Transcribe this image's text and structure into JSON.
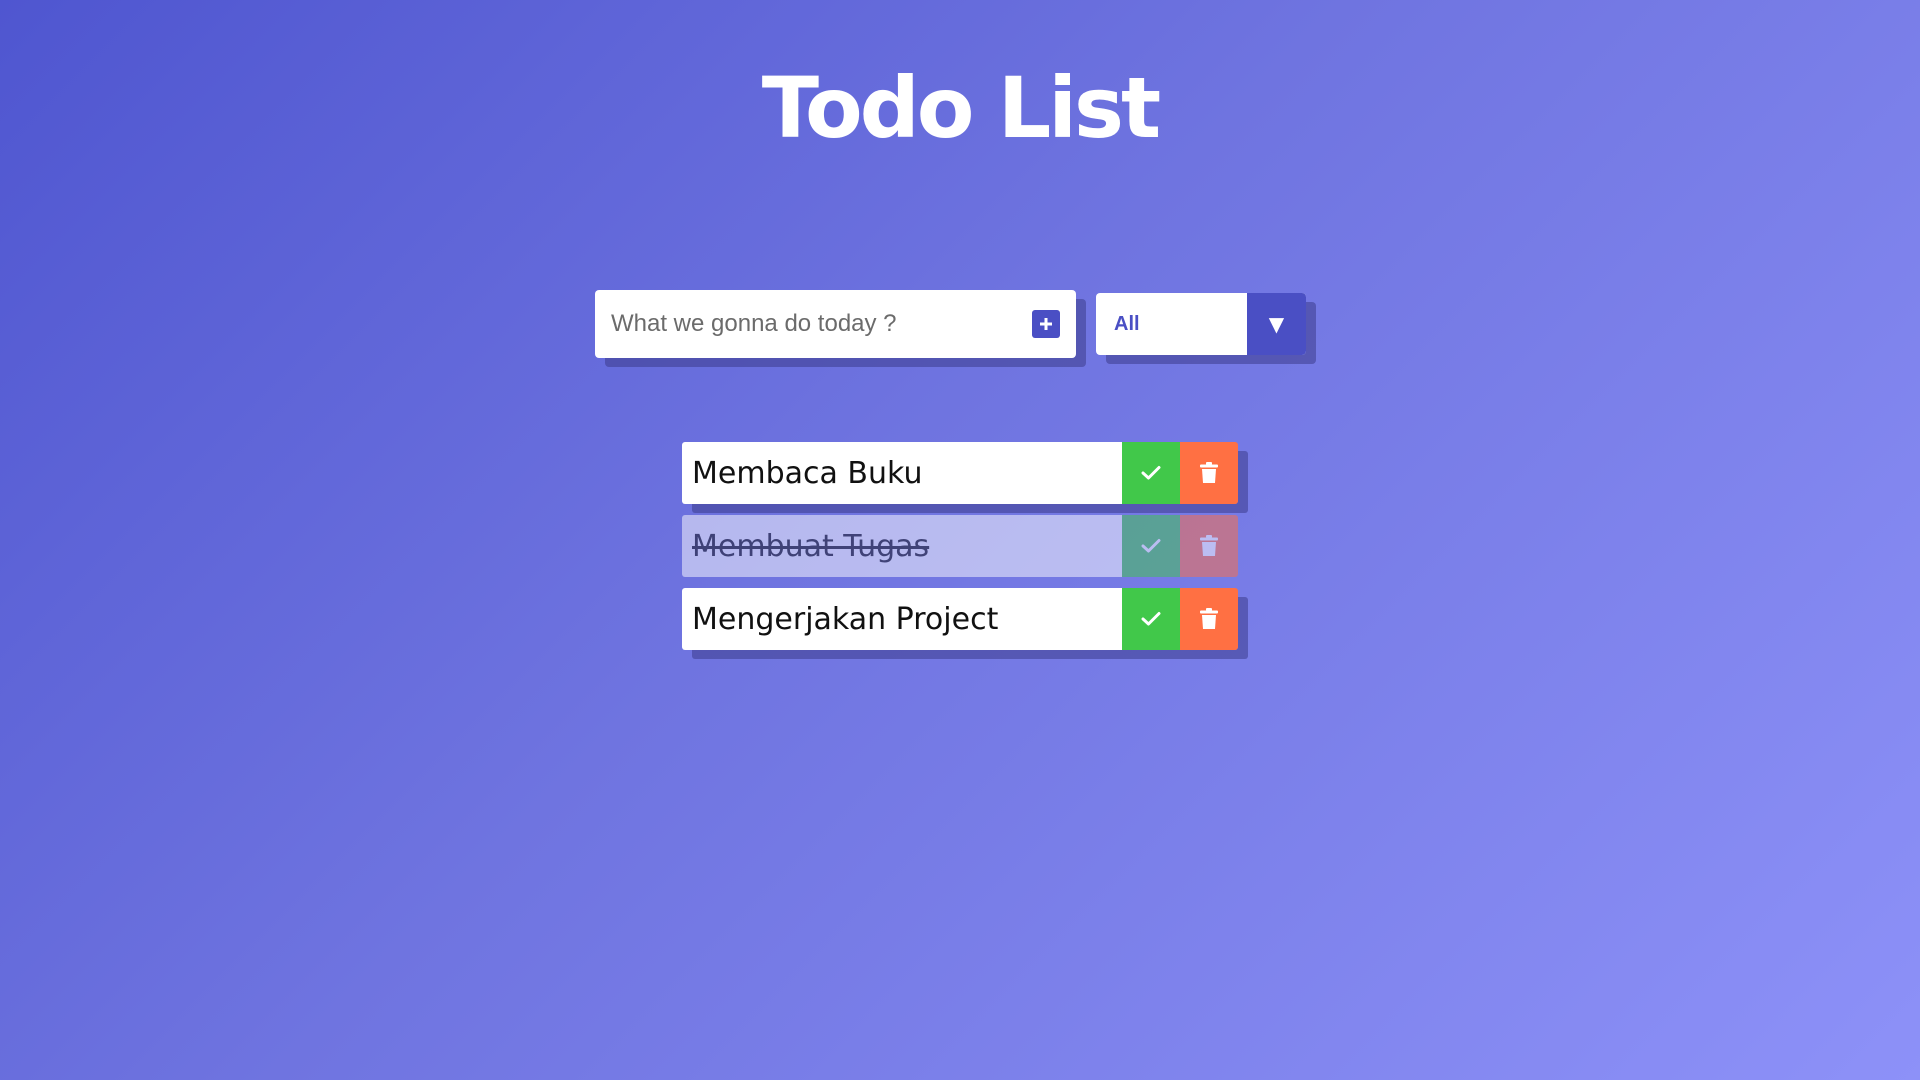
{
  "header": {
    "title": "Todo List"
  },
  "form": {
    "input_placeholder": "What we gonna do today ?",
    "input_value": "",
    "add_icon": "plus-square-icon"
  },
  "filter": {
    "selected": "All",
    "arrow_icon": "caret-down-icon"
  },
  "todos": [
    {
      "text": "Membaca Buku",
      "completed": false
    },
    {
      "text": "Membuat Tugas",
      "completed": true
    },
    {
      "text": "Mengerjakan Project",
      "completed": false
    }
  ],
  "colors": {
    "accent": "#4a4fc4",
    "complete_button": "#41c84a",
    "delete_button": "#ff7043"
  }
}
